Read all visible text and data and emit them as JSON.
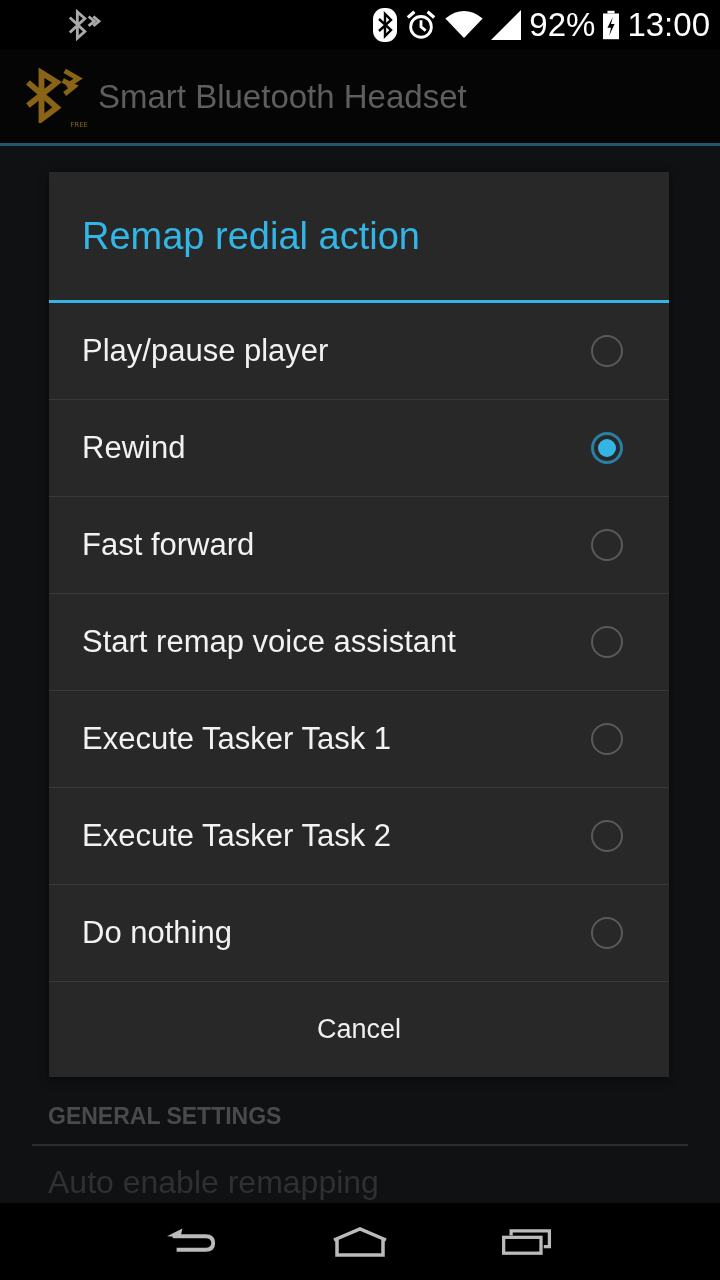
{
  "status_bar": {
    "battery": "92%",
    "time": "13:00"
  },
  "action_bar": {
    "title": "Smart Bluetooth Headset",
    "logo_badge": "FREE"
  },
  "background": {
    "section": "GENERAL SETTINGS",
    "item": "Auto enable remapping"
  },
  "dialog": {
    "title": "Remap redial action",
    "options": [
      {
        "label": "Play/pause player",
        "selected": false
      },
      {
        "label": "Rewind",
        "selected": true
      },
      {
        "label": "Fast forward",
        "selected": false
      },
      {
        "label": "Start remap voice assistant",
        "selected": false
      },
      {
        "label": "Execute Tasker Task 1",
        "selected": false
      },
      {
        "label": "Execute Tasker Task 2",
        "selected": false
      },
      {
        "label": "Do nothing",
        "selected": false
      }
    ],
    "buttons": [
      "Cancel"
    ]
  }
}
